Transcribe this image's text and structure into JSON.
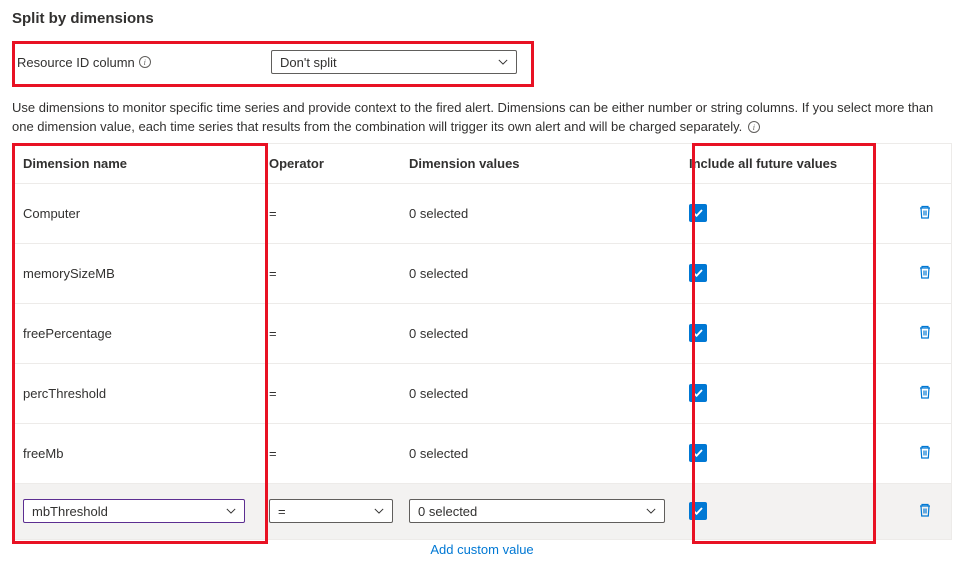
{
  "section_title": "Split by dimensions",
  "resource": {
    "label": "Resource ID column",
    "value": "Don't split"
  },
  "description": "Use dimensions to monitor specific time series and provide context to the fired alert. Dimensions can be either number or string columns. If you select more than one dimension value, each time series that results from the combination will trigger its own alert and will be charged separately.",
  "columns": {
    "name": "Dimension name",
    "operator": "Operator",
    "values": "Dimension values",
    "include": "Include all future values"
  },
  "rows": [
    {
      "name": "Computer",
      "operator": "=",
      "values": "0 selected",
      "include": true
    },
    {
      "name": "memorySizeMB",
      "operator": "=",
      "values": "0 selected",
      "include": true
    },
    {
      "name": "freePercentage",
      "operator": "=",
      "values": "0 selected",
      "include": true
    },
    {
      "name": "percThreshold",
      "operator": "=",
      "values": "0 selected",
      "include": true
    },
    {
      "name": "freeMb",
      "operator": "=",
      "values": "0 selected",
      "include": true
    }
  ],
  "edit_row": {
    "name": "mbThreshold",
    "operator": "=",
    "values": "0 selected",
    "include": true
  },
  "add_custom": "Add custom value"
}
